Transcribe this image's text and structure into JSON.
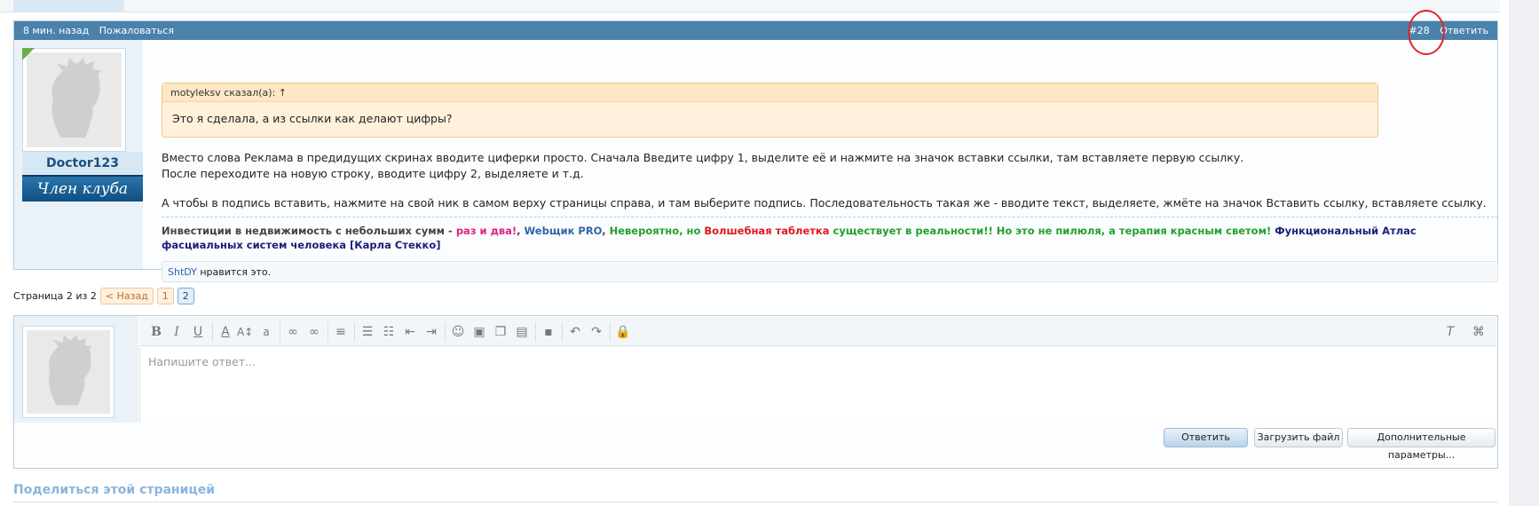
{
  "post": {
    "header": {
      "time": "8 мин. назад",
      "report": "Пожаловаться",
      "number": "#28",
      "reply": "Ответить"
    },
    "user": {
      "name": "Doctor123",
      "rank": "Член клуба"
    },
    "quote": {
      "author": "motyleksv сказал(а): ↑",
      "text": "Это я сделала, а из ссылки как делают цифры?"
    },
    "text": {
      "line1": "Вместо слова Реклама в предидущих скринах вводите циферки просто. Сначала Введите цифру 1, выделите её и нажмите на значок вставки ссылки, там вставляете первую ссылку.",
      "line2": "После переходите на новую строку, вводите цифру 2, выделяете и т.д.",
      "line3": "А чтобы в подпись вставить, нажмите на свой ник в самом верху страницы справа, и там выберите подпись. Последовательность такая же - вводите текст, выделяете, жмёте на значок Вставить ссылку, вставляете ссылку."
    },
    "signature": {
      "part1": "Инвестиции в недвижимость с небольших сумм",
      "dash1": " - ",
      "part2": "раз и два!",
      "comma1": ", ",
      "part3": "Webщик PRO",
      "comma2": ", ",
      "part4": "Невероятно, но ",
      "part5": "Волшебная таблетка",
      "part6": " существует в реальности!! Но это не пилюля, а терапия красным светом!",
      "part7": " Функциональный Атлас фасциальных систем человека [Карла Стекко]"
    },
    "likes": {
      "liker": "ShtDY",
      "text": " нравится это."
    }
  },
  "pagination": {
    "label": "Страница 2 из 2",
    "prev": "< Назад",
    "pages": [
      "1",
      "2"
    ]
  },
  "reply_box": {
    "placeholder": "Напишите ответ...",
    "submit": "Ответить",
    "upload": "Загрузить файл",
    "more": "Дополнительные параметры..."
  },
  "share": {
    "title": "Поделиться этой страницей"
  },
  "colors": {
    "header_bg": "#4a82ab",
    "rank_bg": "#1a5f95",
    "quote_bg": "#fff1dc",
    "accent_circle": "#e3262b"
  }
}
